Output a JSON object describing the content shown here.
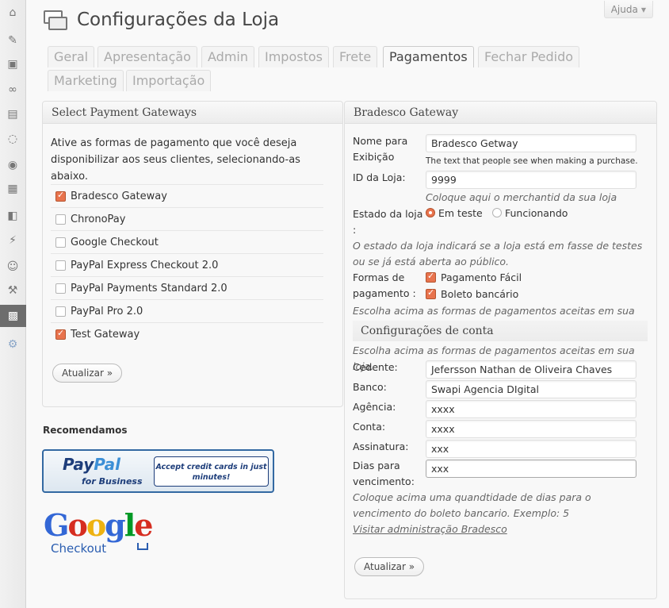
{
  "window": {
    "help_label": "Ajuda"
  },
  "page": {
    "title": "Configurações da Loja"
  },
  "tabs": [
    {
      "label": "Geral",
      "active": false
    },
    {
      "label": "Apresentação",
      "active": false
    },
    {
      "label": "Admin",
      "active": false
    },
    {
      "label": "Impostos",
      "active": false
    },
    {
      "label": "Frete",
      "active": false
    },
    {
      "label": "Pagamentos",
      "active": true
    },
    {
      "label": "Fechar Pedido",
      "active": false
    },
    {
      "label": "Marketing",
      "active": false
    },
    {
      "label": "Importação",
      "active": false
    }
  ],
  "sidebar": {
    "items": [
      {
        "icon": "dashboard-icon",
        "glyph": "⌂"
      },
      {
        "icon": "posts-pin-icon",
        "glyph": "✎"
      },
      {
        "icon": "media-icon",
        "glyph": "▣"
      },
      {
        "icon": "links-icon",
        "glyph": "∞"
      },
      {
        "icon": "pages-icon",
        "glyph": "▤"
      },
      {
        "icon": "comments-icon",
        "glyph": "◌"
      },
      {
        "icon": "store-icon",
        "glyph": "◉"
      },
      {
        "icon": "products-icon",
        "glyph": "▦"
      },
      {
        "icon": "appearance-icon",
        "glyph": "◧"
      },
      {
        "icon": "plugins-icon",
        "glyph": "⚡"
      },
      {
        "icon": "users-icon",
        "glyph": "☺"
      },
      {
        "icon": "tools-icon",
        "glyph": "⚒"
      },
      {
        "icon": "settings-icon",
        "glyph": "▩",
        "current": true
      },
      {
        "icon": "gear-icon",
        "glyph": "⚙"
      }
    ]
  },
  "gateways_box": {
    "title": "Select Payment Gateways",
    "intro": "Ative as formas de pagamento que você deseja disponibilizar aos seus clientes, selecionando-as abaixo.",
    "items": [
      {
        "label": "Bradesco Gateway",
        "checked": true
      },
      {
        "label": "ChronoPay",
        "checked": false
      },
      {
        "label": "Google Checkout",
        "checked": false
      },
      {
        "label": "PayPal Express Checkout 2.0",
        "checked": false
      },
      {
        "label": "PayPal Payments Standard 2.0",
        "checked": false
      },
      {
        "label": "PayPal Pro 2.0",
        "checked": false
      },
      {
        "label": "Test Gateway",
        "checked": true
      }
    ],
    "update_label": "Atualizar »"
  },
  "recommend": {
    "heading": "Recomendamos",
    "paypal": {
      "logo_a": "Pay",
      "logo_b": "Pal",
      "sub": "for Business",
      "box": "Accept credit cards in just minutes!"
    },
    "google": {
      "word": [
        "G",
        "o",
        "o",
        "g",
        "l",
        "e"
      ],
      "sub": "Checkout"
    }
  },
  "bradesco_box": {
    "title": "Bradesco Gateway",
    "nome_label": "Nome para Exibição",
    "nome_value": "Bradesco Getway",
    "nome_desc": "The text that people see when making a purchase.",
    "id_label": "ID da Loja:",
    "id_value": "9999",
    "id_desc": "Coloque aqui o merchantid da sua loja",
    "estado_label": "Estado da loja :",
    "estado_options": [
      {
        "label": "Em teste",
        "checked": true
      },
      {
        "label": "Funcionando",
        "checked": false
      }
    ],
    "estado_desc": "O estado da loja indicará se a loja está em fasse de testes ou se já está aberta ao público.",
    "formas_label": "Formas de pagamento :",
    "formas_options": [
      {
        "label": "Pagamento Fácil",
        "checked": true
      },
      {
        "label": "Boleto bancário",
        "checked": true
      }
    ],
    "formas_desc": "Escolha acima as formas de pagamentos aceitas em sua loja.",
    "conta_heading": "Configurações de conta",
    "conta_desc": "Escolha acima as formas de pagamentos aceitas em sua loja.",
    "cedente_label": "Cedente:",
    "cedente_value": "Jefersson Nathan de Oliveira Chaves",
    "banco_label": "Banco:",
    "banco_value": "Swapi Agencia DIgital",
    "agencia_label": "Agência:",
    "agencia_value": "xxxx",
    "conta_label": "Conta:",
    "conta_value": "xxxx",
    "assinatura_label": "Assinatura:",
    "assinatura_value": "xxx",
    "dias_label": "Dias para vencimento:",
    "dias_value": "xxx",
    "dias_desc": "Coloque acima uma quandtidade de dias para o vencimento do boleto bancario. Exemplo: 5",
    "admin_link": "Visitar administração Bradesco",
    "update_label": "Atualizar »"
  },
  "colors": {
    "accent": "#e8734d",
    "link": "#666666",
    "brand_blue": "#1d3d7a"
  }
}
